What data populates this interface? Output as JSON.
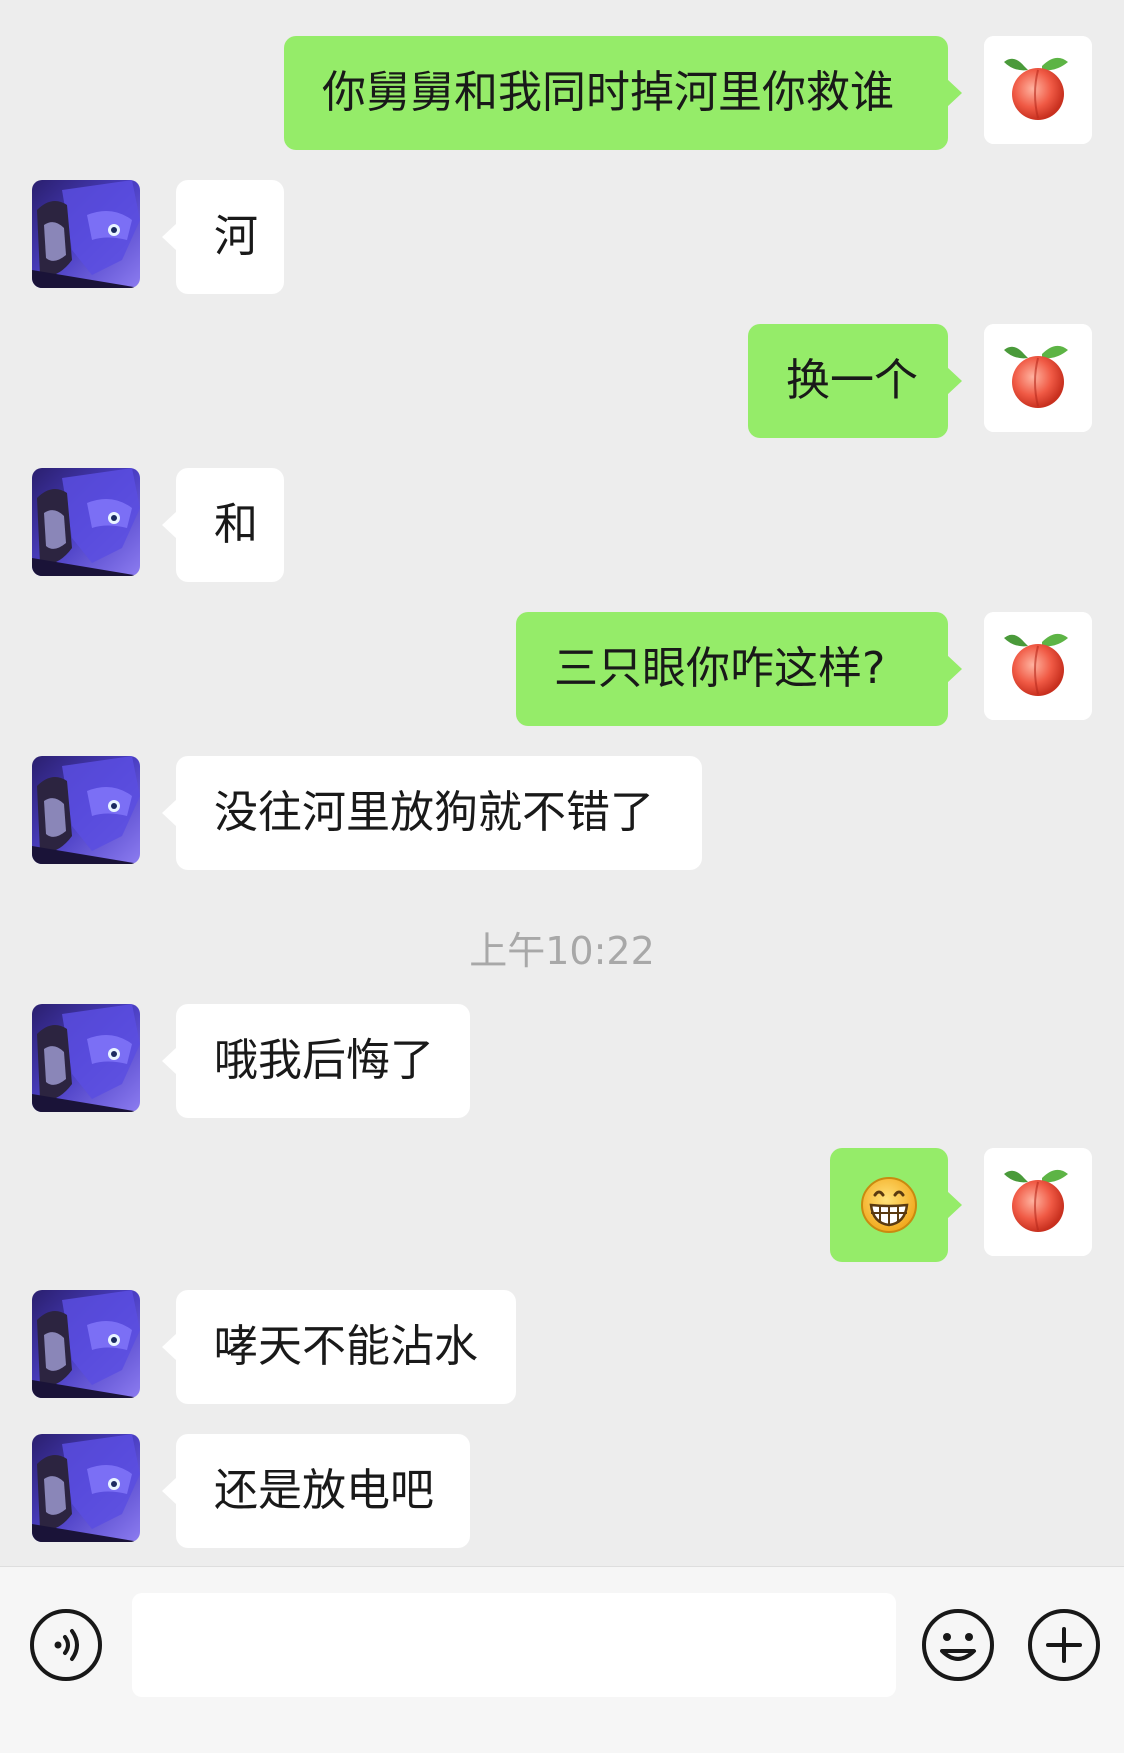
{
  "colors": {
    "background": "#ededed",
    "incoming_bubble": "#ffffff",
    "outgoing_bubble": "#95ec69",
    "timestamp_text": "#a8a8a8"
  },
  "messages": [
    {
      "side": "out",
      "text": "你舅舅和我同时掉河里你救谁",
      "avatar": "peach-avatar"
    },
    {
      "side": "in",
      "text": "河",
      "avatar": "character-avatar"
    },
    {
      "side": "out",
      "text": "换一个",
      "avatar": "peach-avatar"
    },
    {
      "side": "in",
      "text": "和",
      "avatar": "character-avatar"
    },
    {
      "side": "out",
      "text": "三只眼你咋这样?",
      "avatar": "peach-avatar"
    },
    {
      "side": "in",
      "text": "没往河里放狗就不错了",
      "avatar": "character-avatar"
    },
    {
      "side": "in",
      "text": "哦我后悔了",
      "avatar": "character-avatar"
    },
    {
      "side": "out",
      "text": "",
      "emoji": "grin-emoji",
      "avatar": "peach-avatar"
    },
    {
      "side": "in",
      "text": "哮天不能沾水",
      "avatar": "character-avatar"
    },
    {
      "side": "in",
      "text": "还是放电吧",
      "avatar": "character-avatar"
    }
  ],
  "timestamp": "上午10:22",
  "input_bar": {
    "voice_icon": "voice-icon",
    "text_value": "",
    "emoji_icon": "emoji-icon",
    "plus_icon": "plus-icon"
  }
}
